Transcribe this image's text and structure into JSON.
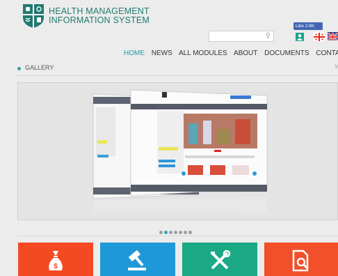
{
  "header": {
    "title_line1": "HEALTH MANAGEMENT",
    "title_line2": "INFORMATION SYSTEM",
    "search_placeholder": "",
    "facebook_like": "Like 2.8K"
  },
  "nav": {
    "items": [
      "HOME",
      "NEWS",
      "ALL MODULES",
      "ABOUT",
      "DOCUMENTS",
      "CONTACT"
    ],
    "active": "HOME"
  },
  "gallery": {
    "label": "GALLERY",
    "slides": 7,
    "active_slide": 2
  },
  "icons": {
    "logo": "medical-cross-shield-icon",
    "search": "search-icon",
    "user": "user-icon",
    "flag_ge": "georgia-flag-icon",
    "flag_uk": "uk-flag-icon",
    "tiles": [
      "money-bag-icon",
      "gavel-icon",
      "tools-icon",
      "document-search-icon"
    ]
  },
  "colors": {
    "brand": "#1f7a70",
    "nav_active": "#1f9aa8",
    "tile1": "#f44a24",
    "tile2": "#1f98d8",
    "tile3": "#1aa885",
    "tile4": "#f24f2b"
  }
}
